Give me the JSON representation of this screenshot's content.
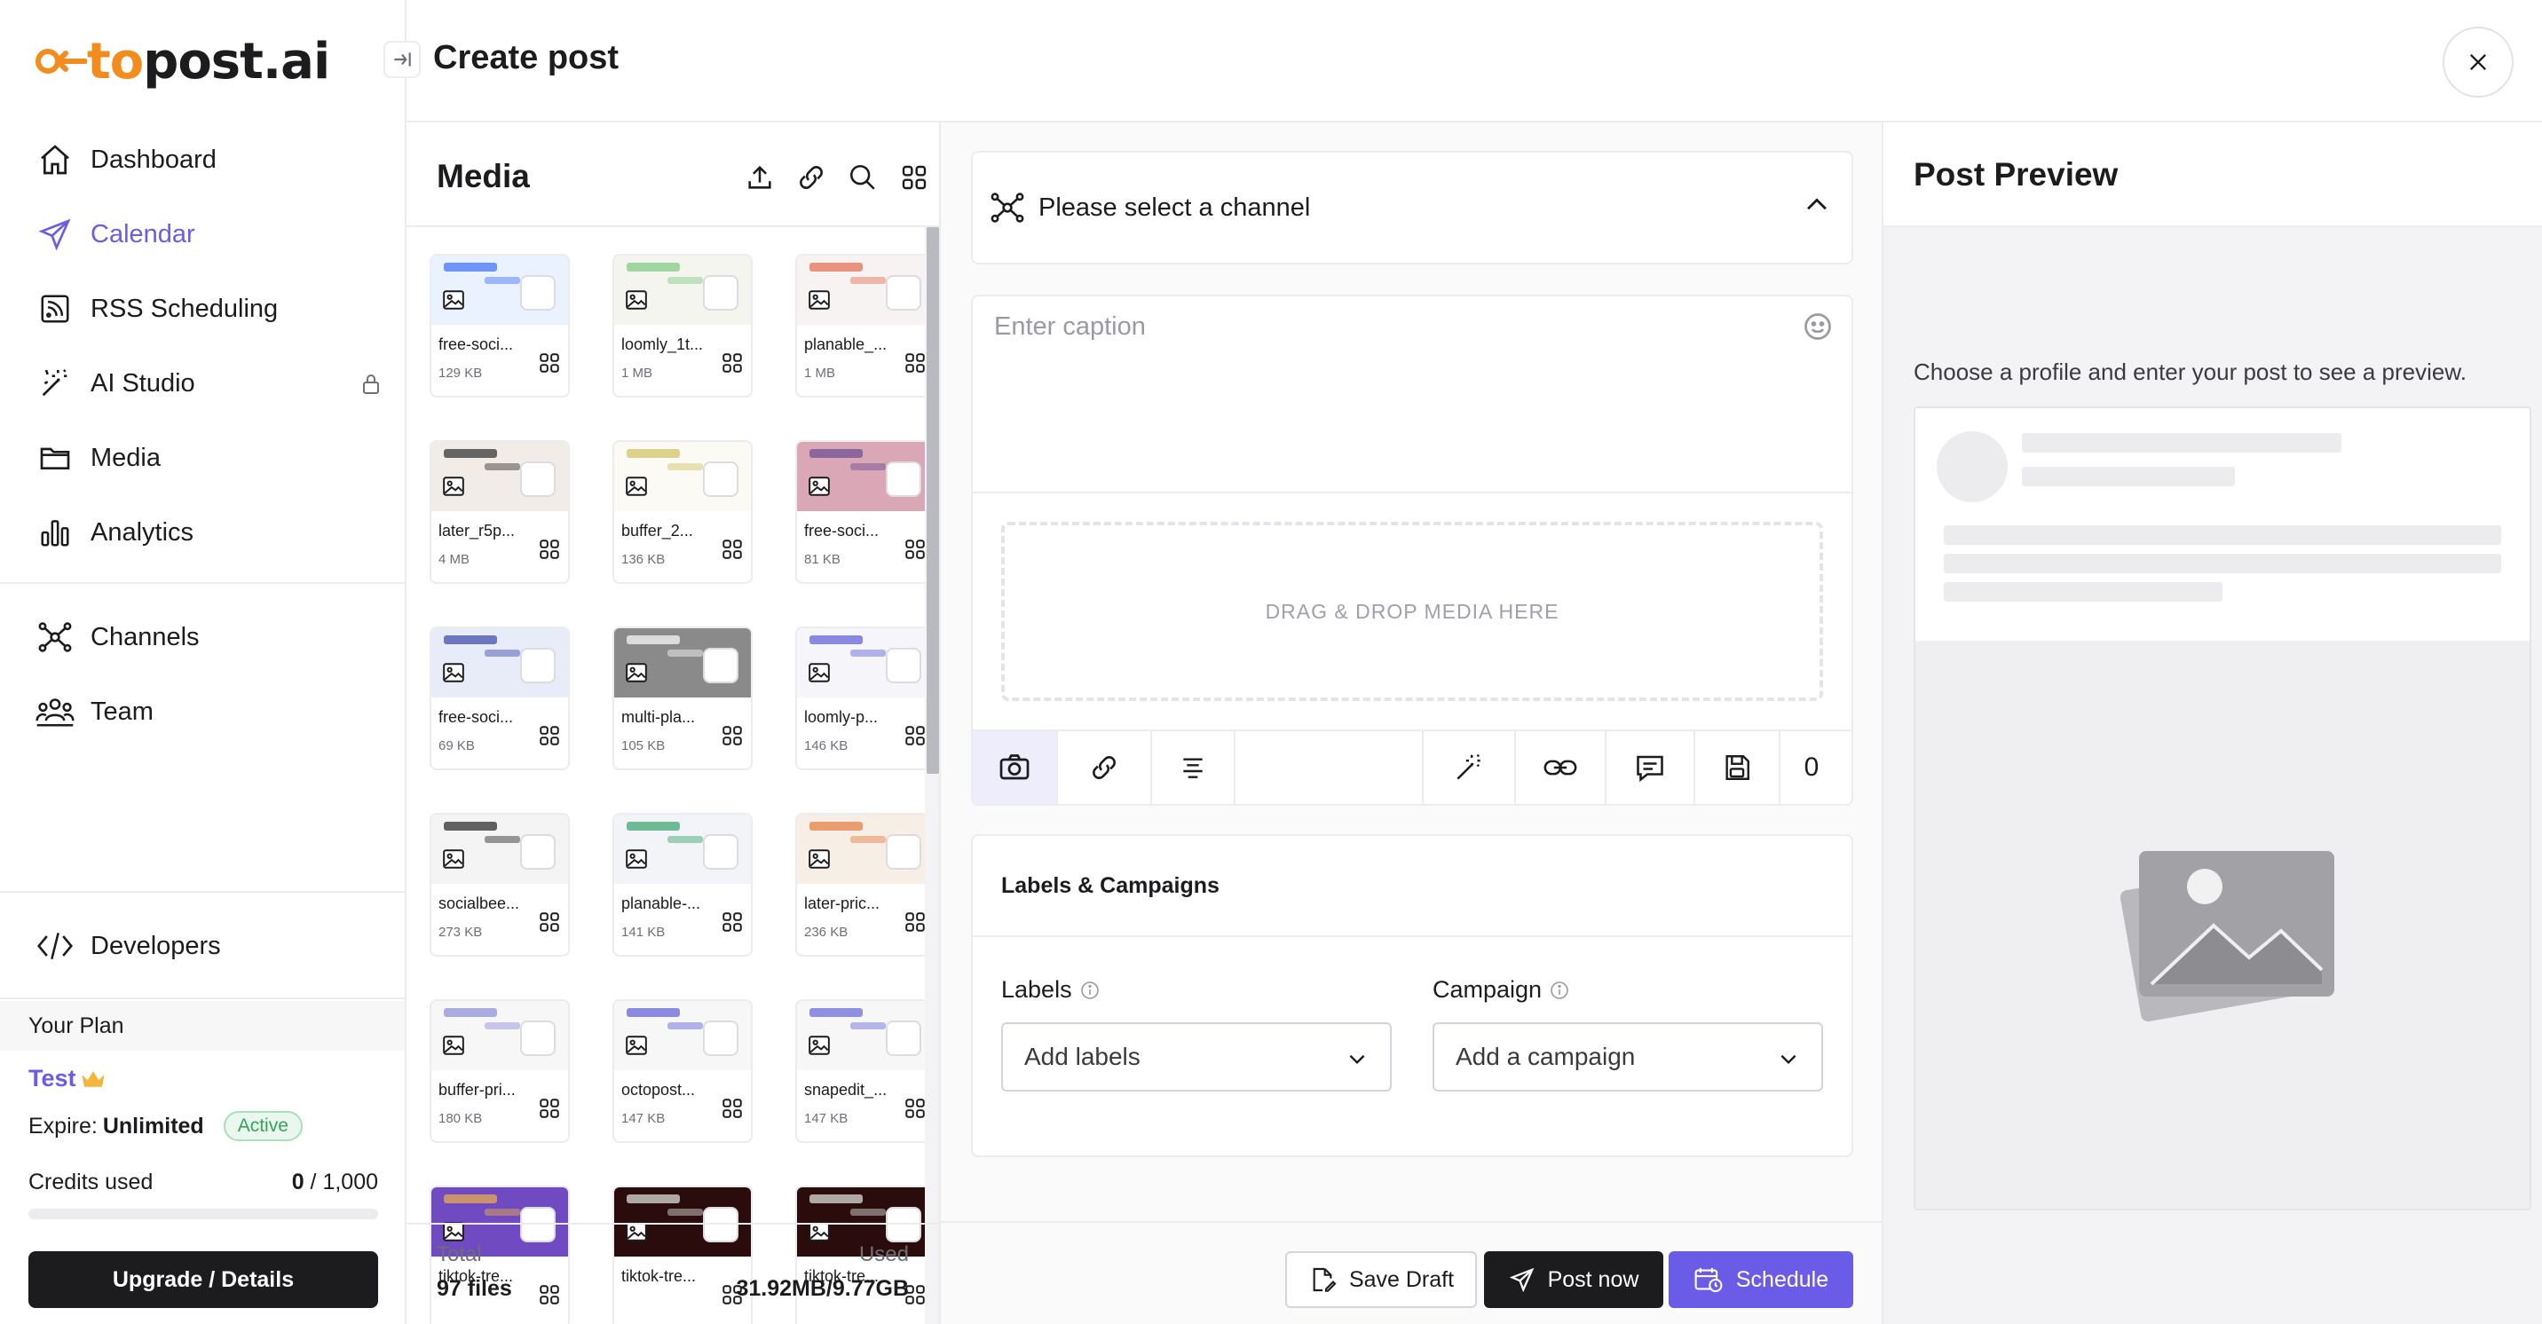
{
  "app": {
    "logo_prefix": "octo",
    "logo_rest": "post.ai",
    "page_title": "Create post",
    "accent_color": "#6b5ce7",
    "brand_color": "#f28c1c"
  },
  "sidebar": {
    "nav": [
      {
        "label": "Dashboard",
        "icon": "home-icon"
      },
      {
        "label": "Calendar",
        "icon": "send-icon",
        "active": true
      },
      {
        "label": "RSS Scheduling",
        "icon": "rss-icon"
      },
      {
        "label": "AI Studio",
        "icon": "magic-wand-icon",
        "locked": true
      },
      {
        "label": "Media",
        "icon": "folder-icon"
      },
      {
        "label": "Analytics",
        "icon": "bar-chart-icon"
      }
    ],
    "nav2": [
      {
        "label": "Channels",
        "icon": "network-icon"
      },
      {
        "label": "Team",
        "icon": "team-icon"
      }
    ],
    "developers": "Developers",
    "plan": {
      "header": "Your Plan",
      "name": "Test",
      "expire_label": "Expire:",
      "expire_value": "Unlimited",
      "status": "Active",
      "credits_label": "Credits used",
      "credits_used": "0",
      "credits_total": "/ 1,000",
      "credits_fraction": 0,
      "upgrade_label": "Upgrade / Details"
    }
  },
  "media": {
    "title": "Media",
    "files": [
      {
        "name": "free-soci...",
        "size": "129 KB"
      },
      {
        "name": "loomly_1t...",
        "size": "1 MB"
      },
      {
        "name": "planable_...",
        "size": "1 MB"
      },
      {
        "name": "later_r5p...",
        "size": "4 MB"
      },
      {
        "name": "buffer_2...",
        "size": "136 KB"
      },
      {
        "name": "free-soci...",
        "size": "81 KB"
      },
      {
        "name": "free-soci...",
        "size": "69 KB"
      },
      {
        "name": "multi-pla...",
        "size": "105 KB"
      },
      {
        "name": "loomly-p...",
        "size": "146 KB"
      },
      {
        "name": "socialbee...",
        "size": "273 KB"
      },
      {
        "name": "planable-...",
        "size": "141 KB"
      },
      {
        "name": "later-pric...",
        "size": "236 KB"
      },
      {
        "name": "buffer-pri...",
        "size": "180 KB"
      },
      {
        "name": "octopost...",
        "size": "147 KB"
      },
      {
        "name": "snapedit_...",
        "size": "147 KB"
      },
      {
        "name": "tiktok-tre...",
        "size": ""
      },
      {
        "name": "tiktok-tre...",
        "size": ""
      },
      {
        "name": "tiktok-tre...",
        "size": ""
      }
    ],
    "total_label": "Total",
    "total_value": "97 files",
    "used_label": "Used",
    "used_value": "31.92MB/9.77GB"
  },
  "editor": {
    "channel_placeholder": "Please select a channel",
    "caption_placeholder": "Enter caption",
    "dropzone_text": "DRAG & DROP MEDIA HERE",
    "char_count": "0",
    "labels_campaigns_title": "Labels & Campaigns",
    "labels_label": "Labels",
    "labels_placeholder": "Add labels",
    "campaign_label": "Campaign",
    "campaign_placeholder": "Add a campaign",
    "save_draft": "Save Draft",
    "post_now": "Post now",
    "schedule": "Schedule"
  },
  "preview": {
    "title": "Post Preview",
    "hint": "Choose a profile and enter your post to see a preview."
  }
}
